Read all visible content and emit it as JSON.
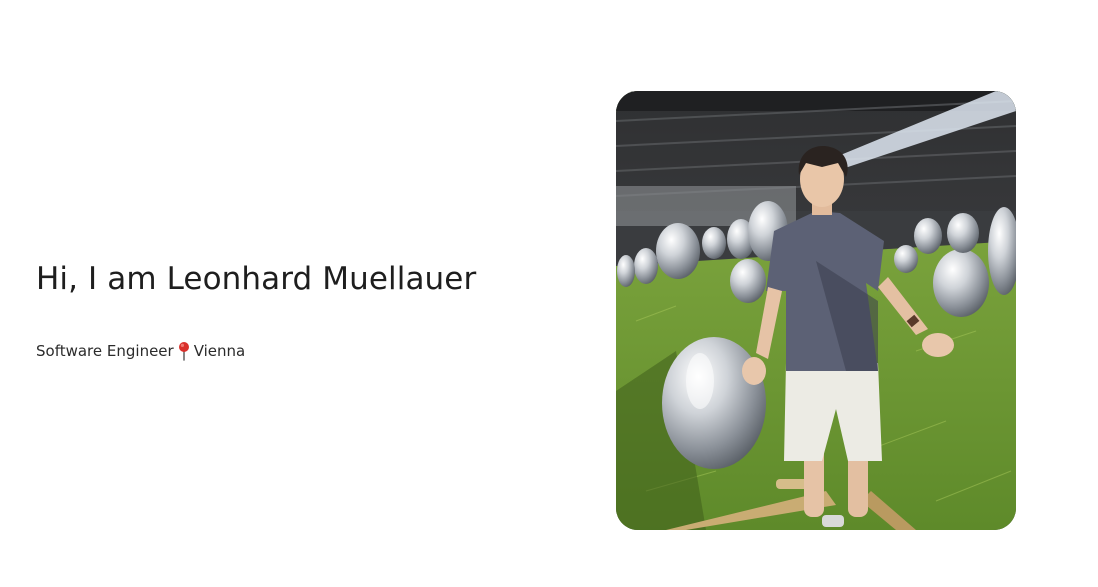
{
  "hero": {
    "greeting": "Hi, I am Leonhard Muellauer",
    "role": "Software Engineer",
    "location_icon": "round-pushpin-icon",
    "location": "Vienna"
  },
  "photo": {
    "alt": "Leonhard Muellauer standing among mirrored egg sculptures on a grass field"
  },
  "colors": {
    "text": "#1e1e1e",
    "background": "#ffffff",
    "pin": "#d9302b"
  }
}
